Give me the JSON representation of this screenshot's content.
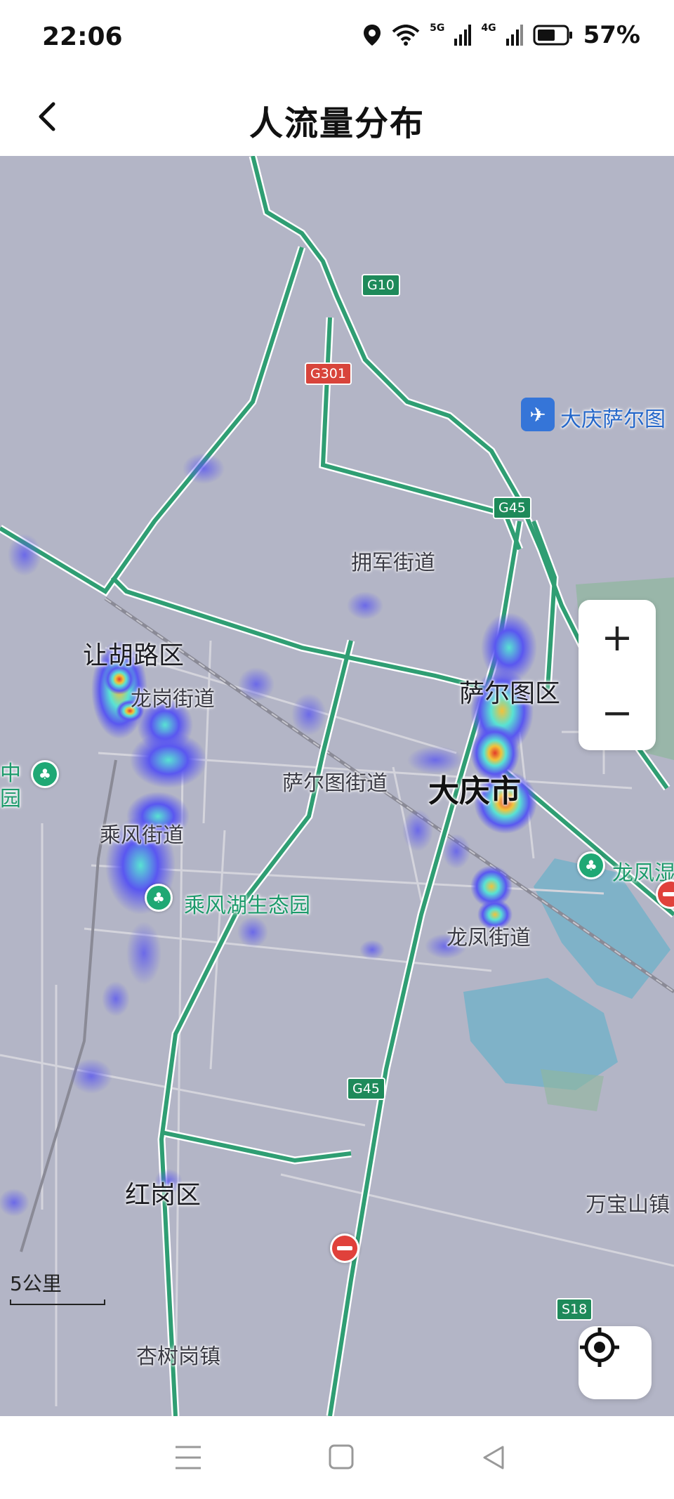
{
  "status_bar": {
    "time": "22:06",
    "network_1": "5G",
    "network_2": "4G",
    "battery": "57%"
  },
  "header": {
    "title": "人流量分布"
  },
  "map": {
    "districts": {
      "ranghulu": "让胡路区",
      "saertu": "萨尔图区",
      "honggang": "红岗区",
      "daqing": "大庆市"
    },
    "streets": {
      "yongjun": "拥军街道",
      "longgang": "龙岗街道",
      "saertu_street": "萨尔图街道",
      "chengfeng": "乘风街道",
      "longfeng": "龙凤街道",
      "wanbaoshan": "万宝山镇",
      "xingshugang": "杏树岗镇"
    },
    "pois": {
      "airport": "大庆萨尔图",
      "chengfeng_lake": "乘风湖生态园",
      "longfeng_wetland": "龙凤湿",
      "left_edge_1": "中",
      "left_edge_2": "园"
    },
    "road_shields": {
      "g10": "G10",
      "g301": "G301",
      "g45_north": "G45",
      "g45_south": "G45",
      "s18": "S18"
    },
    "scale_label": "5公里",
    "controls": {
      "zoom_in": "+",
      "zoom_out": "−"
    },
    "colors": {
      "base": "#b3b5c6",
      "highway": "#2f9e73",
      "water": "#7fb2c8",
      "heat_low": "#5a57f0",
      "heat_mid": "#59e2d3",
      "heat_high": "#e33b2a"
    }
  }
}
